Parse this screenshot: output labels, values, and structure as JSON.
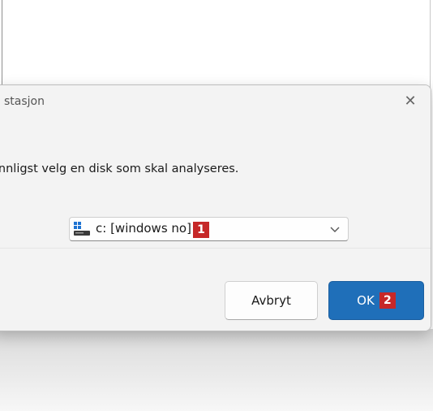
{
  "dialog": {
    "title": "stasjon",
    "close_icon": "close-icon",
    "prompt": "ennligst velg en disk som skal analyseres.",
    "drive_select": {
      "selected_value": "c: [windows no]",
      "icon": "drive-icon",
      "callout": "1"
    },
    "buttons": {
      "cancel_label": "Avbryt",
      "ok_label": "OK",
      "ok_callout": "2"
    }
  },
  "colors": {
    "primary_button": "#1f6fb9",
    "callout_badge": "#c62828"
  }
}
